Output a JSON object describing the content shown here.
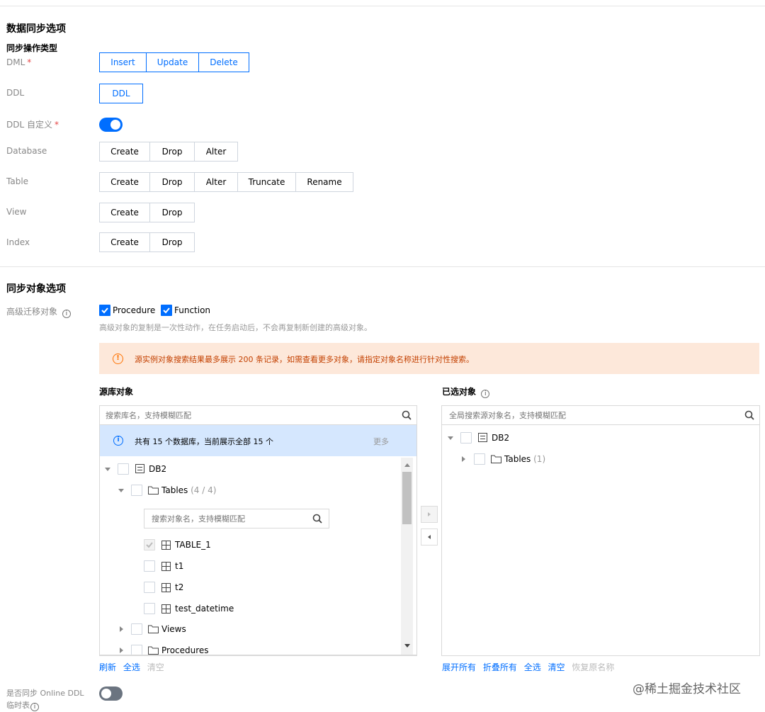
{
  "sections": {
    "data_sync": "数据同步选项",
    "sync_op_type": "同步操作类型",
    "sync_object": "同步对象选项"
  },
  "rows": {
    "dml": {
      "label": "DML",
      "required": "*",
      "buttons": [
        "Insert",
        "Update",
        "Delete"
      ]
    },
    "ddl": {
      "label": "DDL",
      "buttons": [
        "DDL"
      ]
    },
    "ddl_custom": {
      "label": "DDL 自定义",
      "required": "*"
    },
    "database": {
      "label": "Database",
      "buttons": [
        "Create",
        "Drop",
        "Alter"
      ]
    },
    "table": {
      "label": "Table",
      "buttons": [
        "Create",
        "Drop",
        "Alter",
        "Truncate",
        "Rename"
      ]
    },
    "view": {
      "label": "View",
      "buttons": [
        "Create",
        "Drop"
      ]
    },
    "index": {
      "label": "Index",
      "buttons": [
        "Create",
        "Drop"
      ]
    }
  },
  "advanced": {
    "label": "高级迁移对象",
    "options": [
      "Procedure",
      "Function"
    ],
    "hint": "高级对象的复制是一次性动作，在任务启动后，不会再复制新创建的高级对象。"
  },
  "alert": "源实例对象搜索结果最多展示 200 条记录，如需查看更多对象，请指定对象名称进行针对性搜索。",
  "source": {
    "title": "源库对象",
    "search_placeholder": "搜索库名，支持模糊匹配",
    "info": "共有 15 个数据库，当前展示全部 15 个",
    "more": "更多",
    "db": "DB2",
    "tables_label": "Tables",
    "tables_count": "(4 / 4)",
    "inner_search_placeholder": "搜索对象名，支持模糊匹配",
    "tables": [
      "TABLE_1",
      "t1",
      "t2",
      "test_datetime"
    ],
    "views": "Views",
    "procedures": "Procedures",
    "footer": {
      "refresh": "刷新",
      "select_all": "全选",
      "clear": "清空"
    }
  },
  "target": {
    "title": "已选对象",
    "search_placeholder": "全局搜索源对象名，支持模糊匹配",
    "db": "DB2",
    "tables_label": "Tables",
    "tables_count": "(1)",
    "footer": {
      "expand_all": "展开所有",
      "collapse_all": "折叠所有",
      "select_all": "全选",
      "clear": "清空",
      "restore": "恢复原名称"
    }
  },
  "online_ddl": {
    "label_line1": "是否同步 Online DDL",
    "label_line2": "临时表"
  },
  "watermark": "@稀土掘金技术社区",
  "colors": {
    "primary": "#006eff",
    "alert_bg": "#fde8da",
    "alert_icon": "#ff7200",
    "info_bg": "#d5e7fe"
  }
}
